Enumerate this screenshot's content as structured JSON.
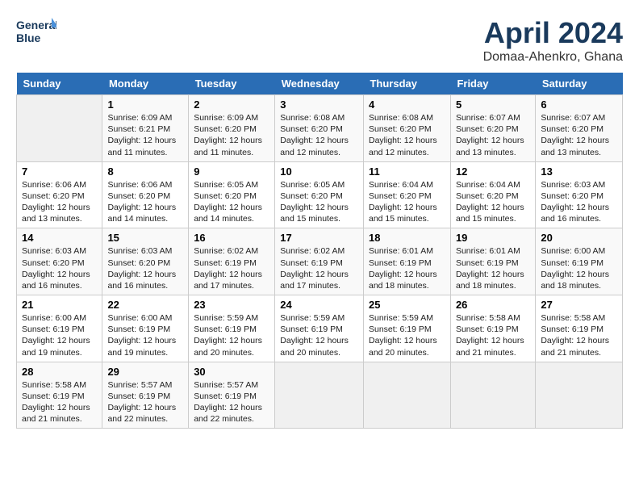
{
  "header": {
    "logo_line1": "General",
    "logo_line2": "Blue",
    "month": "April 2024",
    "location": "Domaa-Ahenkro, Ghana"
  },
  "days_of_week": [
    "Sunday",
    "Monday",
    "Tuesday",
    "Wednesday",
    "Thursday",
    "Friday",
    "Saturday"
  ],
  "weeks": [
    [
      {
        "day": "",
        "content": ""
      },
      {
        "day": "1",
        "content": "Sunrise: 6:09 AM\nSunset: 6:21 PM\nDaylight: 12 hours and 11 minutes."
      },
      {
        "day": "2",
        "content": "Sunrise: 6:09 AM\nSunset: 6:20 PM\nDaylight: 12 hours and 11 minutes."
      },
      {
        "day": "3",
        "content": "Sunrise: 6:08 AM\nSunset: 6:20 PM\nDaylight: 12 hours and 12 minutes."
      },
      {
        "day": "4",
        "content": "Sunrise: 6:08 AM\nSunset: 6:20 PM\nDaylight: 12 hours and 12 minutes."
      },
      {
        "day": "5",
        "content": "Sunrise: 6:07 AM\nSunset: 6:20 PM\nDaylight: 12 hours and 13 minutes."
      },
      {
        "day": "6",
        "content": "Sunrise: 6:07 AM\nSunset: 6:20 PM\nDaylight: 12 hours and 13 minutes."
      }
    ],
    [
      {
        "day": "7",
        "content": "Sunrise: 6:06 AM\nSunset: 6:20 PM\nDaylight: 12 hours and 13 minutes."
      },
      {
        "day": "8",
        "content": "Sunrise: 6:06 AM\nSunset: 6:20 PM\nDaylight: 12 hours and 14 minutes."
      },
      {
        "day": "9",
        "content": "Sunrise: 6:05 AM\nSunset: 6:20 PM\nDaylight: 12 hours and 14 minutes."
      },
      {
        "day": "10",
        "content": "Sunrise: 6:05 AM\nSunset: 6:20 PM\nDaylight: 12 hours and 15 minutes."
      },
      {
        "day": "11",
        "content": "Sunrise: 6:04 AM\nSunset: 6:20 PM\nDaylight: 12 hours and 15 minutes."
      },
      {
        "day": "12",
        "content": "Sunrise: 6:04 AM\nSunset: 6:20 PM\nDaylight: 12 hours and 15 minutes."
      },
      {
        "day": "13",
        "content": "Sunrise: 6:03 AM\nSunset: 6:20 PM\nDaylight: 12 hours and 16 minutes."
      }
    ],
    [
      {
        "day": "14",
        "content": "Sunrise: 6:03 AM\nSunset: 6:20 PM\nDaylight: 12 hours and 16 minutes."
      },
      {
        "day": "15",
        "content": "Sunrise: 6:03 AM\nSunset: 6:20 PM\nDaylight: 12 hours and 16 minutes."
      },
      {
        "day": "16",
        "content": "Sunrise: 6:02 AM\nSunset: 6:19 PM\nDaylight: 12 hours and 17 minutes."
      },
      {
        "day": "17",
        "content": "Sunrise: 6:02 AM\nSunset: 6:19 PM\nDaylight: 12 hours and 17 minutes."
      },
      {
        "day": "18",
        "content": "Sunrise: 6:01 AM\nSunset: 6:19 PM\nDaylight: 12 hours and 18 minutes."
      },
      {
        "day": "19",
        "content": "Sunrise: 6:01 AM\nSunset: 6:19 PM\nDaylight: 12 hours and 18 minutes."
      },
      {
        "day": "20",
        "content": "Sunrise: 6:00 AM\nSunset: 6:19 PM\nDaylight: 12 hours and 18 minutes."
      }
    ],
    [
      {
        "day": "21",
        "content": "Sunrise: 6:00 AM\nSunset: 6:19 PM\nDaylight: 12 hours and 19 minutes."
      },
      {
        "day": "22",
        "content": "Sunrise: 6:00 AM\nSunset: 6:19 PM\nDaylight: 12 hours and 19 minutes."
      },
      {
        "day": "23",
        "content": "Sunrise: 5:59 AM\nSunset: 6:19 PM\nDaylight: 12 hours and 20 minutes."
      },
      {
        "day": "24",
        "content": "Sunrise: 5:59 AM\nSunset: 6:19 PM\nDaylight: 12 hours and 20 minutes."
      },
      {
        "day": "25",
        "content": "Sunrise: 5:59 AM\nSunset: 6:19 PM\nDaylight: 12 hours and 20 minutes."
      },
      {
        "day": "26",
        "content": "Sunrise: 5:58 AM\nSunset: 6:19 PM\nDaylight: 12 hours and 21 minutes."
      },
      {
        "day": "27",
        "content": "Sunrise: 5:58 AM\nSunset: 6:19 PM\nDaylight: 12 hours and 21 minutes."
      }
    ],
    [
      {
        "day": "28",
        "content": "Sunrise: 5:58 AM\nSunset: 6:19 PM\nDaylight: 12 hours and 21 minutes."
      },
      {
        "day": "29",
        "content": "Sunrise: 5:57 AM\nSunset: 6:19 PM\nDaylight: 12 hours and 22 minutes."
      },
      {
        "day": "30",
        "content": "Sunrise: 5:57 AM\nSunset: 6:19 PM\nDaylight: 12 hours and 22 minutes."
      },
      {
        "day": "",
        "content": ""
      },
      {
        "day": "",
        "content": ""
      },
      {
        "day": "",
        "content": ""
      },
      {
        "day": "",
        "content": ""
      }
    ]
  ]
}
